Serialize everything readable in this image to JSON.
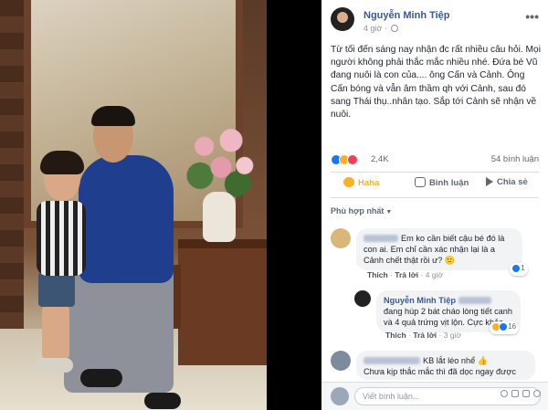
{
  "post": {
    "author": "Nguyễn Minh Tiệp",
    "time": "4 giờ",
    "more": "•••",
    "text": "Từ tối đến sáng nay nhận đc rất nhiều câu hỏi. Mọi người không phải thắc mắc nhiều nhé. Đứa bé Vũ đang nuôi là con của.... ông Cấn và Cảnh. Ông Cấn bóng và vẫn âm thầm qh với Cảnh, sau đó sang Thái thụ..nhân tạo. Sắp tới Cảnh sẽ nhận về nuôi.",
    "reaction_count": "2,4K",
    "comment_count": "54 bình luận",
    "actions": {
      "haha": "Haha",
      "comment": "Bình luận",
      "share": "Chia sẻ"
    },
    "sort_label": "Phù hợp nhất"
  },
  "comments": [
    {
      "text": "Em ko cần biết cậu bé đó là con ai. Em chỉ cần xác nhận lại là a Cảnh chết thật rồi ư? 🙁",
      "reply": "Trả lời",
      "like": "Thích",
      "time": "4 giờ",
      "reactions": "1"
    },
    {
      "author": "Nguyễn Minh Tiệp",
      "text": "đang húp 2 bát cháo lòng tiết canh và 4 quả trứng vịt lộn. Cực khỏe.",
      "reply": "Trả lời",
      "like": "Thích",
      "time": "3 giờ",
      "reactions": "16"
    },
    {
      "text": "KB lắt léo nhể 👍",
      "text2": "Chưa kịp thắc mắc thì đã dọc ngay được"
    }
  ],
  "composer": {
    "placeholder": "Viết bình luận..."
  },
  "colors": {
    "link": "#385898",
    "haha": "#f7b125",
    "like": "#1877f2"
  }
}
